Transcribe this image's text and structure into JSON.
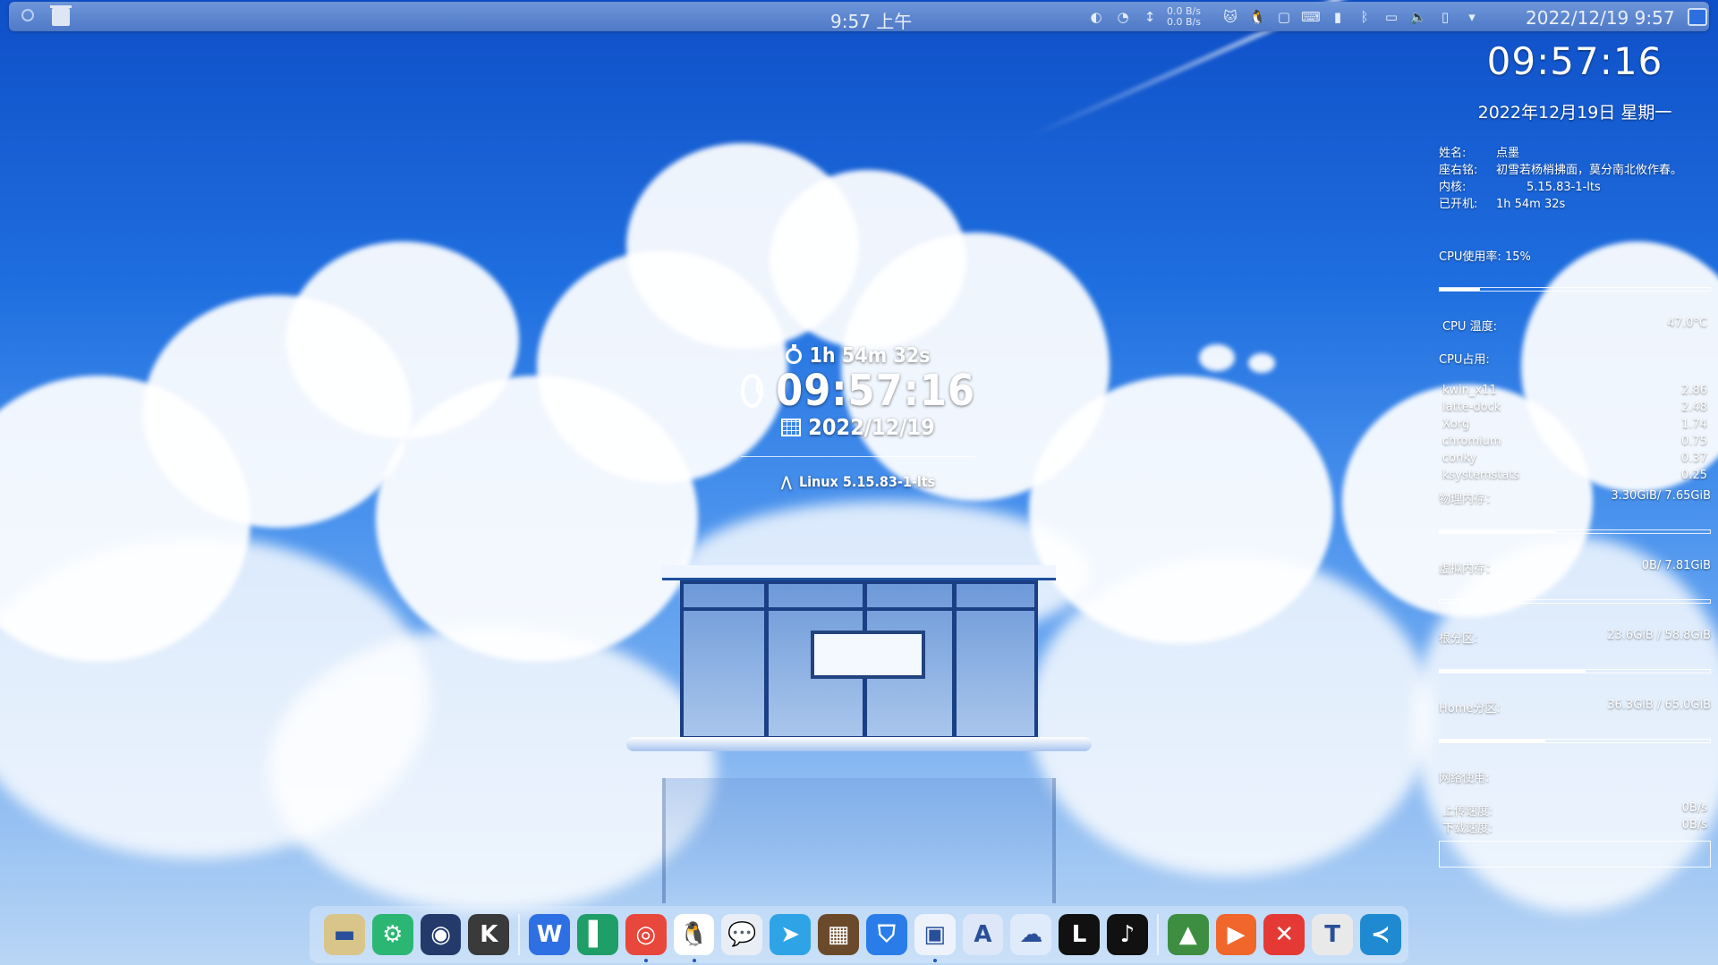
{
  "top_panel": {
    "clock": "9:57 上午",
    "net_up": "0.0 B/s",
    "net_down": "0.0 B/s",
    "datetime": "2022/12/19  9:57",
    "tray_icons": [
      "kdeconnect-icon",
      "cpu-monitor-icon",
      "network-arrows-icon",
      "cat-icon",
      "qq-tray-icon",
      "clipboard-icon",
      "keyboard-icon",
      "battery-icon",
      "bluetooth-icon",
      "display-icon",
      "volume-icon",
      "phone-icon",
      "expand-arrow-icon"
    ]
  },
  "center_widget": {
    "uptime": "1h 54m 32s",
    "time": "09:57:16",
    "date": "2022/12/19",
    "kernel": "Linux 5.15.83-1-lts"
  },
  "conky": {
    "clock": "09:57:16",
    "date": "2022年12月19日 星期一",
    "name_label": "姓名:",
    "name_value": "点墨",
    "motto_label": "座右铭:",
    "motto_value": "初雪若杨梢拂面，莫分南北攸作春。",
    "kernel_label": "内核:",
    "kernel_value": "5.15.83-1-lts",
    "uptime_label": "已开机:",
    "uptime_value": "1h 54m 32s",
    "cpu_usage_label": "CPU使用率: 15%",
    "cpu_usage_fraction": 0.15,
    "cpu_temp_label": "CPU 温度:",
    "cpu_temp_value": "47.0°C",
    "cpu_top_label": "CPU占用:",
    "processes": [
      {
        "name": "kwin_x11",
        "value": "2.86"
      },
      {
        "name": "latte-dock",
        "value": "2.48"
      },
      {
        "name": "Xorg",
        "value": "1.74"
      },
      {
        "name": "chromium",
        "value": "0.75"
      },
      {
        "name": "conky",
        "value": "0.37"
      },
      {
        "name": "ksystemstats",
        "value": "0.25"
      }
    ],
    "mem_label": "物理内存：",
    "mem_value": "3.30GiB/ 7.65GiB",
    "mem_fraction": 0.43,
    "swap_label": "虚拟内存：",
    "swap_value": "0B/ 7.81GiB",
    "swap_fraction": 0.0,
    "root_label": "根分区:",
    "root_value": "23.6GiB / 58.8GiB",
    "root_fraction": 0.54,
    "home_label": "Home分区:",
    "home_value": "36.3GiB / 65.0GiB",
    "home_fraction": 0.39,
    "network_label": "网络使用:",
    "upload_label": "上传速度:",
    "upload_value": "0B/s",
    "download_label": "下载速度:",
    "download_value": "0B/s"
  },
  "dock": {
    "items": [
      {
        "name": "files-dock-item",
        "color": "#d9c58a",
        "glyph": "▬"
      },
      {
        "name": "settings-dock-item",
        "color": "#2bb673",
        "glyph": "⚙"
      },
      {
        "name": "system-monitor-dock-item",
        "color": "#233a6b",
        "glyph": "◉"
      },
      {
        "name": "kde-dock-item",
        "color": "#3a3a3a",
        "glyph": "K"
      },
      {
        "name": "wps-dock-item",
        "color": "#2f6fe4",
        "glyph": "W"
      },
      {
        "name": "notes-dock-item",
        "color": "#1f9e67",
        "glyph": "▌"
      },
      {
        "name": "chrome-dock-item",
        "color": "#e8473c",
        "glyph": "◎"
      },
      {
        "name": "qq-dock-item",
        "color": "#ffffff",
        "glyph": "🐧"
      },
      {
        "name": "wechat-dock-item",
        "color": "#e9eef6",
        "glyph": "💬"
      },
      {
        "name": "telegram-dock-item",
        "color": "#2ea4e6",
        "glyph": "➤"
      },
      {
        "name": "minecraft-dock-item",
        "color": "#6b4a2b",
        "glyph": "▦"
      },
      {
        "name": "security-dock-item",
        "color": "#2a7de8",
        "glyph": "⛉"
      },
      {
        "name": "screenshot-dock-item",
        "color": "#eef3fb",
        "glyph": "▣"
      },
      {
        "name": "font-dock-item",
        "color": "#dde7f8",
        "glyph": "A"
      },
      {
        "name": "baidu-netdisk-dock-item",
        "color": "#dfeafb",
        "glyph": "☁"
      },
      {
        "name": "lark-dock-item",
        "color": "#111111",
        "glyph": "L"
      },
      {
        "name": "tiktok-dock-item",
        "color": "#111111",
        "glyph": "♪"
      },
      {
        "name": "android-studio-dock-item",
        "color": "#3e8e41",
        "glyph": "▲"
      },
      {
        "name": "player-dock-item",
        "color": "#f1662a",
        "glyph": "▶"
      },
      {
        "name": "xmind-dock-item",
        "color": "#e53935",
        "glyph": "✕"
      },
      {
        "name": "typora-dock-item",
        "color": "#e9e9e9",
        "glyph": "T"
      },
      {
        "name": "vscode-dock-item",
        "color": "#1f8ad2",
        "glyph": "≺"
      }
    ]
  }
}
